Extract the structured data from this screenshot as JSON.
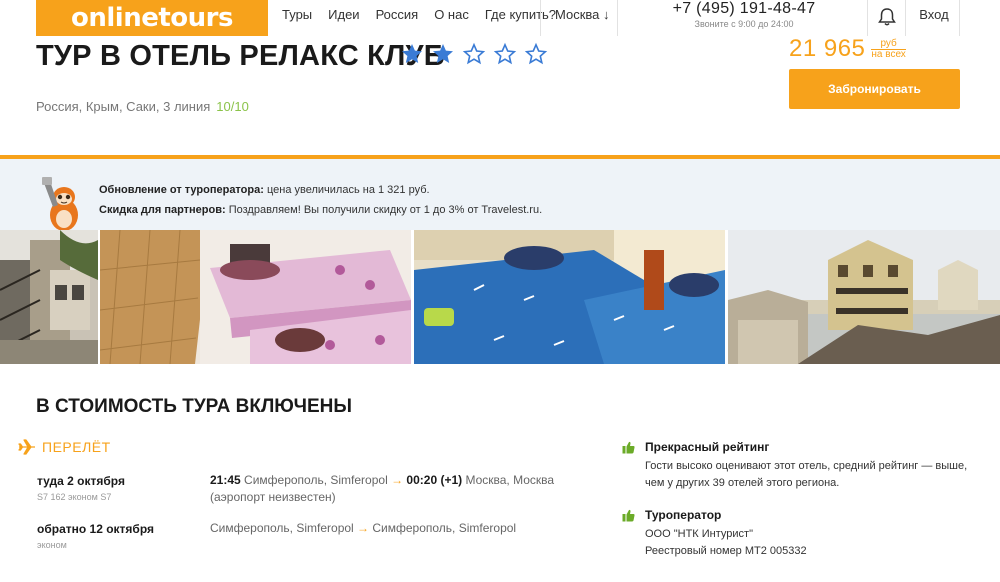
{
  "header": {
    "logo": "onlinetours",
    "nav": [
      "Туры",
      "Идеи",
      "Россия",
      "О нас",
      "Где купить?"
    ],
    "city": "Москва ↓",
    "phone": "+7 (495) 191-48-47",
    "phone_hours": "Звоните с 9:00 до 24:00",
    "login": "Вход"
  },
  "hotel": {
    "title": "ТУР В ОТЕЛЬ РЕЛАКС КЛУБ",
    "stars_filled": 2,
    "stars_total": 5,
    "location": "Россия, Крым, Саки, 3 линия",
    "rating": "10/10"
  },
  "price": {
    "amount": "21 965",
    "unit_top": "руб",
    "unit_bottom": "на всех",
    "book_label": "Забронировать"
  },
  "notice": {
    "update_label": "Обновление от туроператора:",
    "update_text": " цена увеличилась на 1 321 руб.",
    "discount_label": "Скидка для партнеров:",
    "discount_text": " Поздравляем! Вы получили скидку от 1 до 3% от Travelest.ru."
  },
  "colors": {
    "accent": "#f7a21b",
    "star": "#3a7bd5",
    "rating": "#8bc34a",
    "thumb": "#6bab28"
  },
  "included": {
    "title": "В СТОИМОСТЬ ТУРА ВКЛЮЧЕНЫ",
    "flight_title": "ПЕРЕЛЁТ",
    "outbound": {
      "label": "туда 2 октября",
      "sub": "S7 162 эконом S7",
      "time": "21:45",
      "from": " Симферополь, Simferopol ",
      "arrow": "→",
      "arr_time": "00:20 (+1)",
      "to": " Москва, Москва",
      "airport": "(аэропорт неизвестен)"
    },
    "return": {
      "label": "обратно 12 октября",
      "sub": "эконом",
      "from": "Симферополь, Simferopol ",
      "arrow": "→",
      "to": " Симферополь, Simferopol"
    },
    "rating_block": {
      "title": "Прекрасный рейтинг",
      "text_1": "Гости высоко оценивают этот отель, средний рейтинг — выше,",
      "text_2": "чем у других 39 отелей этого региона."
    },
    "operator_block": {
      "title": "Туроператор",
      "name": "ООО \"НТК Интурист\"",
      "registry": "Реестровый номер МТ2 005332"
    }
  }
}
